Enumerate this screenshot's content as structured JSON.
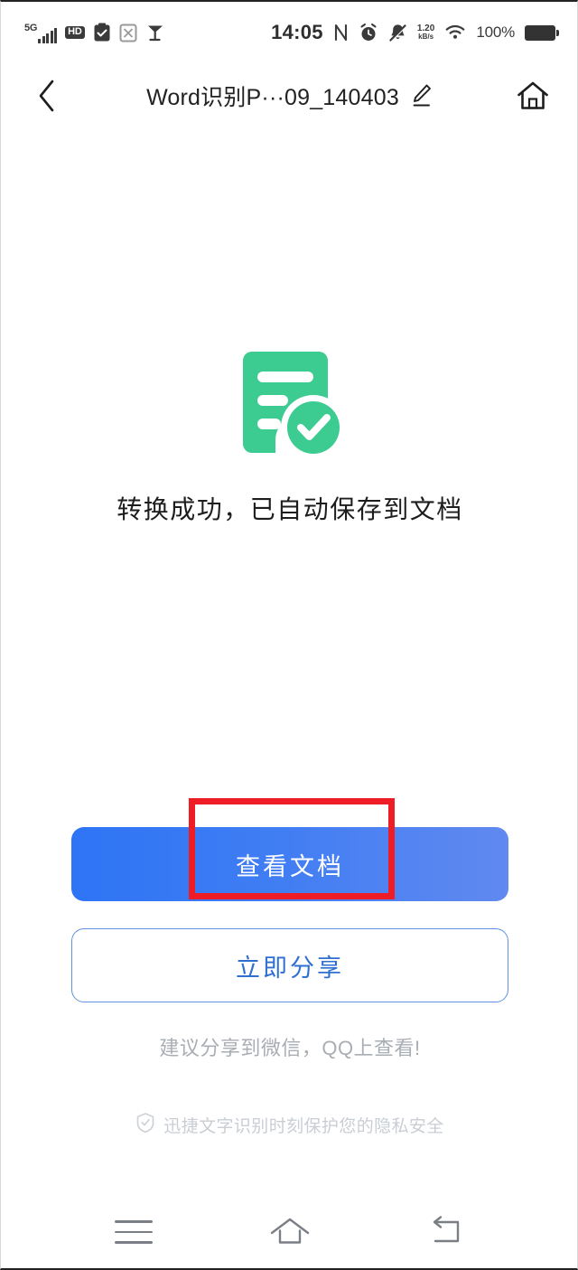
{
  "status_bar": {
    "network_type": "5G",
    "signal_bars": 5,
    "hd_label": "HD",
    "icons_left": [
      "signal-5g-icon",
      "hd-icon",
      "clipboard-check-icon",
      "sim-icon",
      "broadcast-icon"
    ],
    "time": "14:05",
    "nfc_label": "N",
    "alarm_icon": "alarm-clock-icon",
    "silent_icon": "bell-muted-icon",
    "data_rate_value": "1.20",
    "data_rate_unit": "kB/s",
    "wifi_icon": "wifi-icon",
    "battery_percent": "100%",
    "battery_icon": "battery-full-icon"
  },
  "header": {
    "back_icon": "chevron-left-icon",
    "title": "Word识别P···09_140403",
    "edit_icon": "pencil-edit-icon",
    "home_icon": "home-icon"
  },
  "main": {
    "result_icon": "document-check-icon",
    "result_icon_color": "#3ccb91",
    "success_message": "转换成功，已自动保存到文档",
    "primary_button_label": "查看文档",
    "secondary_button_label": "立即分享",
    "share_hint": "建议分享到微信，QQ上查看!",
    "privacy_icon": "shield-check-icon",
    "privacy_note": "迅捷文字识别时刻保护您的隐私安全"
  },
  "annotation": {
    "type": "highlight-rectangle",
    "color": "#ee1c25",
    "targets": "查看文档"
  },
  "nav_bar": {
    "menu_icon": "menu-icon",
    "home_icon": "home-outline-icon",
    "back_icon": "back-arrow-icon"
  },
  "theme": {
    "primary_blue_start": "#2e74f5",
    "primary_blue_end": "#6189f0",
    "outline_blue": "#5e92e0",
    "success_green": "#3ccb91",
    "annotation_red": "#ee1c25",
    "text_dark": "#1d1d1d",
    "text_muted": "#a9aeb4",
    "background": "#ffffff"
  }
}
